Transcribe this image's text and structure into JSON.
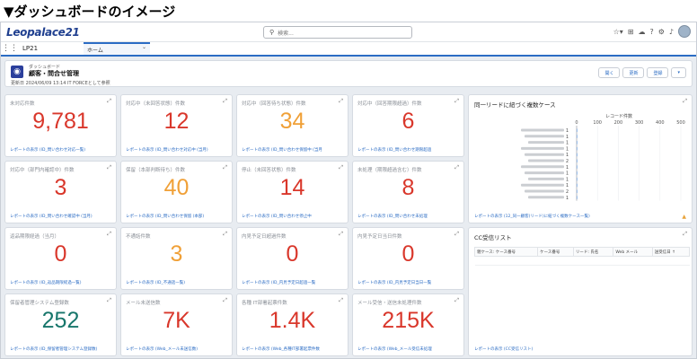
{
  "caption": "▼ダッシュボードのイメージ",
  "header": {
    "logo": "Leopalace21",
    "search_placeholder": "検索...",
    "app_name": "LP21",
    "tab_label": "ホーム"
  },
  "dashboard": {
    "label": "ダッシュボード",
    "title": "顧客・問合せ管理",
    "updated": "更新日 2024/06/09 13:14 IT FORCEとして参照",
    "buttons": [
      "開く",
      "更新",
      "登録"
    ]
  },
  "metric_cards": [
    {
      "title": "未対応件数",
      "value": "9,781",
      "color": "red",
      "link": "レポートの表示 (ID_問い合わせ対応一覧)"
    },
    {
      "title": "対応中（未回答状態）件数",
      "value": "12",
      "color": "red",
      "link": "レポートの表示 (ID_問い合わせ対応中 (当月)"
    },
    {
      "title": "対応中（回答待ち状態）件数",
      "value": "34",
      "color": "orange",
      "link": "レポートの表示 (ID_問い合わせ保留中 (当月"
    },
    {
      "title": "対応中（回答期限超過）件数",
      "value": "6",
      "color": "red",
      "link": "レポートの表示 (ID_問い合わせ期限超過"
    },
    {
      "title": "対応中（部門内確認中）件数",
      "value": "3",
      "color": "red",
      "link": "レポートの表示 (ID_問い合わせ確認中 (当月)"
    },
    {
      "title": "保留（本部判断待ち）件数",
      "value": "40",
      "color": "orange",
      "link": "レポートの表示 (ID_問い合わせ保留 (本部)"
    },
    {
      "title": "停止（未回答状態）件数",
      "value": "14",
      "color": "red",
      "link": "レポートの表示 (ID_問い合わせ停止中"
    },
    {
      "title": "未処理（期限超過含む）件数",
      "value": "8",
      "color": "red",
      "link": "レポートの表示 (ID_問い合わせ未処理"
    },
    {
      "title": "返品期限経過（当月）",
      "value": "0",
      "color": "red",
      "link": "レポートの表示 (ID_返品期限経過一覧)"
    },
    {
      "title": "不通話件数",
      "value": "3",
      "color": "orange",
      "link": "レポートの表示 (ID_不通話一覧)"
    },
    {
      "title": "内見予定日超過件数",
      "value": "0",
      "color": "red",
      "link": "レポートの表示 (ID_内見予定日超過一覧"
    },
    {
      "title": "内見予定日当日件数",
      "value": "0",
      "color": "red",
      "link": "レポートの表示 (ID_内見予定日当日一覧"
    },
    {
      "title": "保留者管理システム登録数",
      "value": "252",
      "color": "green",
      "link": "レポートの表示 (ID_保留者管理システム登録数)"
    },
    {
      "title": "メール未送信数",
      "value": "7K",
      "color": "red",
      "link": "レポートの表示 (Web_メール未送信数)"
    },
    {
      "title": "各種 IT部署起票件数",
      "value": "1.4K",
      "color": "red",
      "link": "レポートの表示 (Web_各種IT部署起票件数"
    },
    {
      "title": "メール受信・送信未処理件数",
      "value": "215K",
      "color": "red",
      "link": "レポートの表示 (Web_メール受信未処理"
    }
  ],
  "colors": {
    "red": "#d9372b",
    "orange": "#f0a037",
    "green": "#17766b",
    "link": "#2b6cc4"
  },
  "chart_card": {
    "title": "同一リードに紐づく複数ケース",
    "link": "レポートの表示 (12_同一顧客(リード)に紐づく複数ケース一覧)"
  },
  "chart_data": {
    "type": "bar",
    "title": "同一リードに紐づく複数ケース",
    "xlabel": "レコード件数",
    "ylabel": "",
    "xlim": [
      0,
      500
    ],
    "x_ticks": [
      "0",
      "100",
      "200",
      "300",
      "400",
      "500"
    ],
    "categories": [
      "",
      "",
      "",
      "",
      "",
      "",
      "",
      "",
      "",
      "",
      "",
      ""
    ],
    "values": [
      1,
      1,
      1,
      1,
      1,
      2,
      1,
      1,
      1,
      1,
      2,
      1
    ]
  },
  "table_card": {
    "title": "CC受信リスト",
    "columns": [
      "親ケース: ケース番号",
      "ケース番号",
      "リード: 氏名",
      "Web メール",
      "送受信日 ↑"
    ],
    "link": "レポートの表示 (CC受信リスト)"
  }
}
